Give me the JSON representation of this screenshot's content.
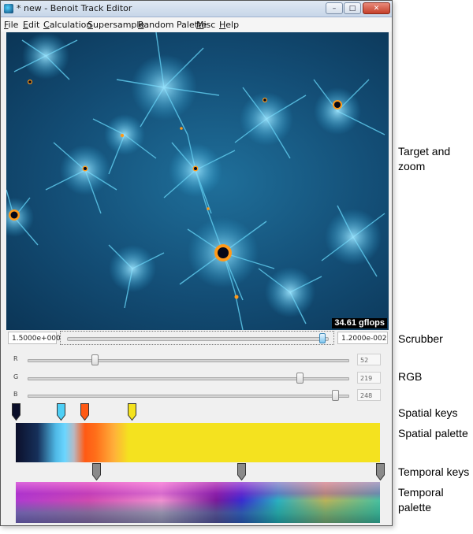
{
  "window": {
    "title": "* new - Benoit Track Editor",
    "buttons": {
      "minimize": "–",
      "maximize": "□",
      "close": "✕"
    }
  },
  "menu": [
    {
      "label": "File",
      "ul": "F",
      "rest": "ile"
    },
    {
      "label": "Edit",
      "ul": "E",
      "rest": "dit"
    },
    {
      "label": "Calculation",
      "ul": "C",
      "rest": "alculation"
    },
    {
      "label": "Supersample",
      "ul": "S",
      "rest": "upersample"
    },
    {
      "label": "Random Palette",
      "ul": "R",
      "rest": "andom Palette"
    },
    {
      "label": "Misc",
      "ul": "M",
      "rest": "isc"
    },
    {
      "label": "Help",
      "ul": "H",
      "rest": "elp"
    }
  ],
  "viewport": {
    "gflops": "34.61 gflops"
  },
  "scrubber": {
    "left_value": "1.5000e+000",
    "right_value": "1.2000e-002",
    "position": 0.97
  },
  "rgb": [
    {
      "label": "R",
      "value": "52",
      "fraction": 0.204
    },
    {
      "label": "G",
      "value": "219",
      "fraction": 0.859
    },
    {
      "label": "B",
      "value": "248",
      "fraction": 0.973
    }
  ],
  "spatial_keys": [
    {
      "color": "#0b0f2a",
      "position": 0.0
    },
    {
      "color": "#4fcff5",
      "position": 0.125
    },
    {
      "color": "#ff5a14",
      "position": 0.19
    },
    {
      "color": "#f4e21f",
      "position": 0.32
    }
  ],
  "temporal_keys": [
    {
      "color": "#8a8a8a",
      "position": 0.22
    },
    {
      "color": "#8a8a8a",
      "position": 0.62
    },
    {
      "color": "#8a8a8a",
      "position": 1.0
    }
  ],
  "annotations": {
    "target_zoom": "Target and zoom",
    "scrubber": "Scrubber",
    "rgb": "RGB",
    "spatial_keys": "Spatial keys",
    "spatial_palette": "Spatial palette",
    "temporal_keys": "Temporal keys",
    "temporal_palette": "Temporal palette"
  }
}
